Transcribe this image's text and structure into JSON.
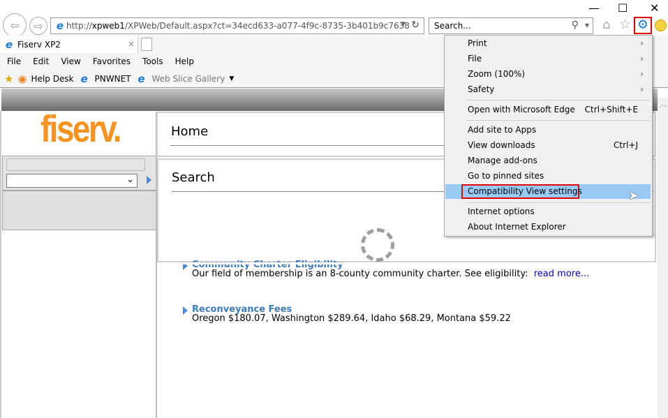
{
  "window": {
    "minimize": "—",
    "maximize": "☐",
    "close": "✕"
  },
  "address": {
    "prefix": "http://",
    "host": "xpweb1",
    "path": "/XPWeb/Default.aspx?ct=34ecd633-a077-4f9c-8735-3b401b9c7638"
  },
  "search": {
    "placeholder": "Search..."
  },
  "tab": {
    "title": "Fiserv XP2"
  },
  "menubar": [
    "File",
    "Edit",
    "View",
    "Favorites",
    "Tools",
    "Help"
  ],
  "favorites": [
    "Help Desk",
    "PNWNET",
    "Web Slice Gallery"
  ],
  "logo": "fiserv.",
  "home_panel": {
    "title": "Home"
  },
  "search_panel": {
    "title": "Search"
  },
  "news": [
    {
      "title": "Community Charter Eligibility",
      "text": "Our field of membership is an 8-county community charter. See eligibility:",
      "link": "read more..."
    },
    {
      "title": "Reconveyance Fees",
      "text": "Oregon $180.07, Washington $289.64, Idaho $68.29, Montana $59.22"
    }
  ],
  "tools_menu": {
    "items": [
      {
        "label": "Print",
        "arrow": "›"
      },
      {
        "label": "File",
        "arrow": "›"
      },
      {
        "label": "Zoom (100%)",
        "arrow": "›"
      },
      {
        "label": "Safety",
        "arrow": "›"
      },
      {
        "label": "Open with Microsoft Edge",
        "shortcut": "Ctrl+Shift+E"
      },
      {
        "label": "Add site to Apps"
      },
      {
        "label": "View downloads",
        "shortcut": "Ctrl+J"
      },
      {
        "label": "Manage add-ons"
      },
      {
        "label": "Go to pinned sites"
      },
      {
        "label": "Compatibility View settings",
        "highlighted": true
      },
      {
        "label": "Internet options"
      },
      {
        "label": "About Internet Explorer"
      }
    ]
  },
  "colors": {
    "accent": "#f7931e",
    "highlight": "#99c9f5",
    "marker": "#e00000",
    "link": "#3d7bbf"
  }
}
